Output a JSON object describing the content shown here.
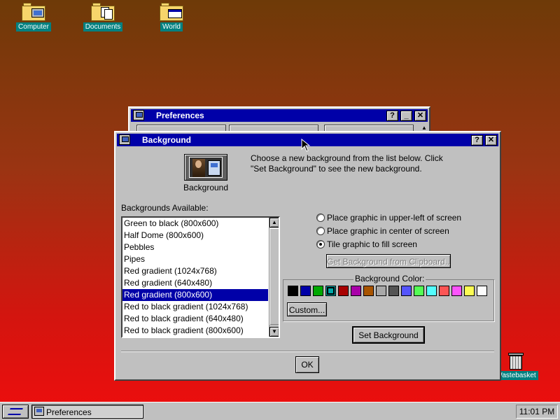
{
  "desktop": {
    "icons": [
      {
        "label": "Computer"
      },
      {
        "label": "Documents"
      },
      {
        "label": "World"
      },
      {
        "label": "Wastebasket"
      }
    ]
  },
  "pref_window": {
    "title": "Preferences",
    "help": "?",
    "minimize": "_",
    "close": "✕"
  },
  "bg_window": {
    "title": "Background",
    "help": "?",
    "close": "✕",
    "instructions_line1": "Choose a new background from the list below. Click",
    "instructions_line2": "\"Set Background\" to see the new background.",
    "icon_label": "Background",
    "list_label": "Backgrounds Available:",
    "list": [
      "Green to black (800x600)",
      "Half Dome (800x600)",
      "Pebbles",
      "Pipes",
      "Red gradient (1024x768)",
      "Red gradient (640x480)",
      "Red gradient (800x600)",
      "Red to black gradient (1024x768)",
      "Red to black gradient (640x480)",
      "Red to black gradient (800x600)"
    ],
    "selected_index": 6,
    "options": [
      "Place graphic in upper-left of screen",
      "Place graphic in center of screen",
      "Tile graphic to fill screen"
    ],
    "selected_option": 2,
    "clipboard_button": "Get Background from Clipboard...",
    "color_group_label": "Background Color:",
    "colors": [
      "#000000",
      "#0000a8",
      "#00a800",
      "#00a8a8",
      "#a80000",
      "#a800a8",
      "#a85400",
      "#a8a8a8",
      "#545454",
      "#5454fc",
      "#54fc54",
      "#54fcfc",
      "#fc5454",
      "#fc54fc",
      "#fcfc54",
      "#fcfcfc"
    ],
    "selected_color": 3,
    "custom_button": "Custom...",
    "set_button": "Set Background",
    "ok_button": "OK"
  },
  "taskbar": {
    "task_label": "Preferences",
    "clock": "11:01 PM"
  }
}
